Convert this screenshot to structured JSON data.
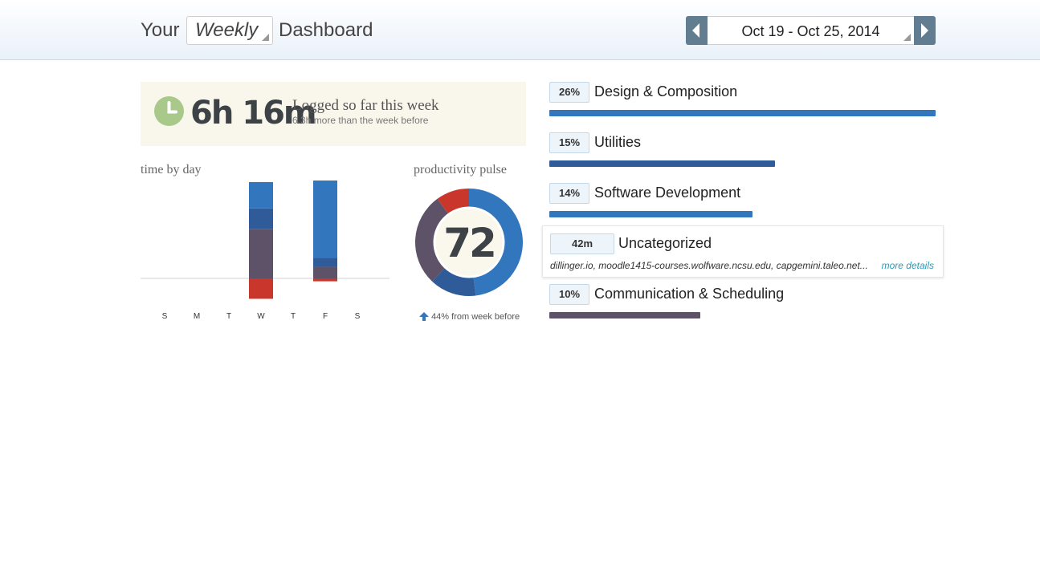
{
  "header": {
    "title_prefix": "Your",
    "period": "Weekly",
    "title_suffix": "Dashboard",
    "date_range": "Oct 19 - Oct 25, 2014"
  },
  "summary": {
    "total_time": "6h 16m",
    "logged_label": "Logged so far this week",
    "comparison": "6.3h more than the week before"
  },
  "time_by_day": {
    "label": "time by day",
    "days": [
      "S",
      "M",
      "T",
      "W",
      "T",
      "F",
      "S"
    ]
  },
  "productivity_pulse": {
    "label": "productivity pulse",
    "score": "72",
    "change": "44% from week before"
  },
  "categories": [
    {
      "badge": "26%",
      "name": "Design & Composition",
      "bar_fraction": 1.0,
      "color": "#3276bd"
    },
    {
      "badge": "15%",
      "name": "Utilities",
      "bar_fraction": 0.585,
      "color": "#2f5b99"
    },
    {
      "badge": "14%",
      "name": "Software Development",
      "bar_fraction": 0.525,
      "color": "#3276bd"
    }
  ],
  "uncategorized": {
    "badge": "42m",
    "name": "Uncategorized",
    "sites": "dillinger.io, moodle1415-courses.wolfware.ncsu.edu, capgemini.taleo.net...",
    "more_details": "more details"
  },
  "communication": {
    "badge": "10%",
    "name": "Communication & Scheduling",
    "bar_fraction": 0.39,
    "color": "#5e5268"
  },
  "colors": {
    "very_productive": "#3276bd",
    "productive": "#2f5b99",
    "neutral": "#5e5268",
    "distracting": "#c9372c",
    "header_nav": "#627d90",
    "clock": "#a8c98a"
  },
  "chart_data": [
    {
      "type": "bar",
      "title": "time by day",
      "categories": [
        "S",
        "M",
        "T",
        "W",
        "T",
        "F",
        "S"
      ],
      "series": [
        {
          "values": [
            0,
            0,
            0,
            0.9,
            0,
            2.7,
            0
          ]
        },
        {
          "values": [
            0,
            0,
            0,
            0.7,
            0,
            0.3,
            0
          ]
        },
        {
          "values": [
            0,
            0,
            0,
            1.7,
            0,
            0.4,
            0
          ]
        },
        {
          "values": [
            0,
            0,
            0,
            -0.7,
            0,
            -0.1,
            0
          ]
        }
      ]
    },
    {
      "type": "pie",
      "title": "productivity pulse",
      "slices": [
        {
          "value": 48
        },
        {
          "value": 14
        },
        {
          "value": 28
        },
        {
          "value": 10
        }
      ]
    }
  ]
}
